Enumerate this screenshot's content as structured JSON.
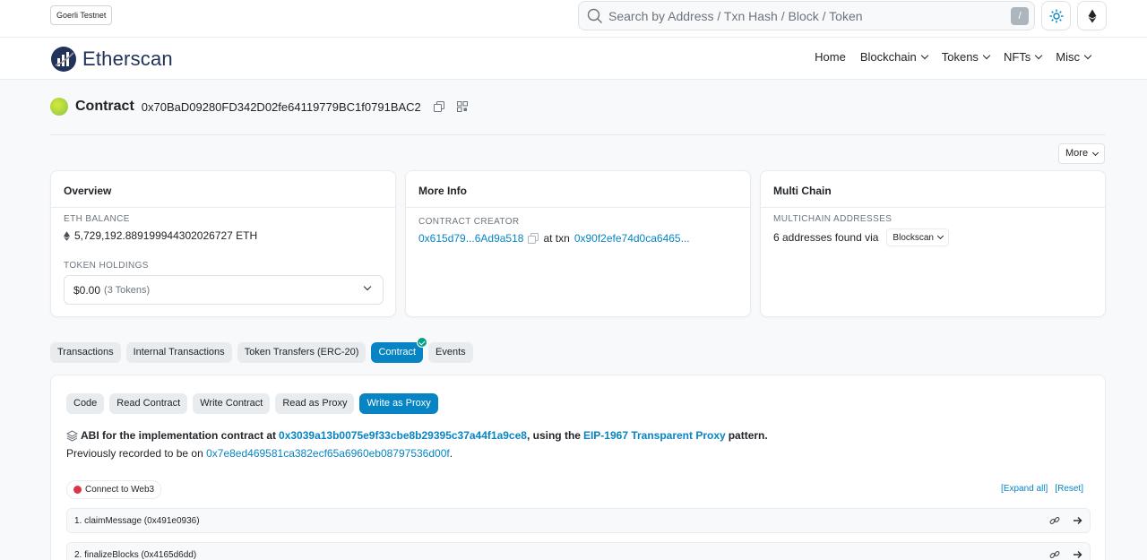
{
  "topbar": {
    "network_badge": "Goerli Testnet",
    "search_placeholder": "Search by Address / Txn Hash / Block / Token",
    "search_shortcut": "/"
  },
  "brand": {
    "name": "Etherscan"
  },
  "nav": [
    {
      "label": "Home",
      "dropdown": false
    },
    {
      "label": "Blockchain",
      "dropdown": true
    },
    {
      "label": "Tokens",
      "dropdown": true
    },
    {
      "label": "NFTs",
      "dropdown": true
    },
    {
      "label": "Misc",
      "dropdown": true
    }
  ],
  "contract": {
    "label": "Contract",
    "address": "0x70BaD09280FD342D02fe64119779BC1f0791BAC2",
    "more_label": "More"
  },
  "overview": {
    "title": "Overview",
    "eth_balance_label": "ETH BALANCE",
    "eth_balance_value": "5,729,192.889199944302026727 ETH",
    "token_holdings_label": "TOKEN HOLDINGS",
    "token_holdings_value": "$0.00",
    "token_holdings_count": "(3 Tokens)"
  },
  "more_info": {
    "title": "More Info",
    "creator_label": "CONTRACT CREATOR",
    "creator_address": "0x615d79...6Ad9a518",
    "at_txn": "at txn",
    "txn_hash": "0x90f2efe74d0ca6465..."
  },
  "multichain": {
    "title": "Multi Chain",
    "label": "MULTICHAIN ADDRESSES",
    "value": "6 addresses found via",
    "provider": "Blockscan"
  },
  "tabs": [
    {
      "label": "Transactions",
      "active": false
    },
    {
      "label": "Internal Transactions",
      "active": false
    },
    {
      "label": "Token Transfers (ERC-20)",
      "active": false
    },
    {
      "label": "Contract",
      "active": true
    },
    {
      "label": "Events",
      "active": false
    }
  ],
  "subtabs": [
    {
      "label": "Code",
      "active": false
    },
    {
      "label": "Read Contract",
      "active": false
    },
    {
      "label": "Write Contract",
      "active": false
    },
    {
      "label": "Read as Proxy",
      "active": false
    },
    {
      "label": "Write as Proxy",
      "active": true
    }
  ],
  "abi": {
    "prefix": "ABI for the implementation contract at",
    "impl_address": "0x3039a13b0075e9f33cbe8b29395c37a44f1a9ce8",
    "middle": ", using the",
    "pattern_link": "EIP-1967 Transparent Proxy",
    "suffix": "pattern.",
    "previous_prefix": "Previously recorded to be on",
    "previous_address": "0x7e8ed469581ca382ecf65a6960eb08797536d00f",
    "previous_suffix": "."
  },
  "connect": {
    "label": "Connect to Web3",
    "status_color": "#dc3545"
  },
  "expand": {
    "expand_all": "[Expand all]",
    "reset": "[Reset]"
  },
  "functions": [
    {
      "label": "1. claimMessage (0x491e0936)"
    },
    {
      "label": "2. finalizeBlocks (0x4165d6dd)"
    }
  ],
  "colors": {
    "accent": "#0784c3",
    "success": "#00a186"
  }
}
